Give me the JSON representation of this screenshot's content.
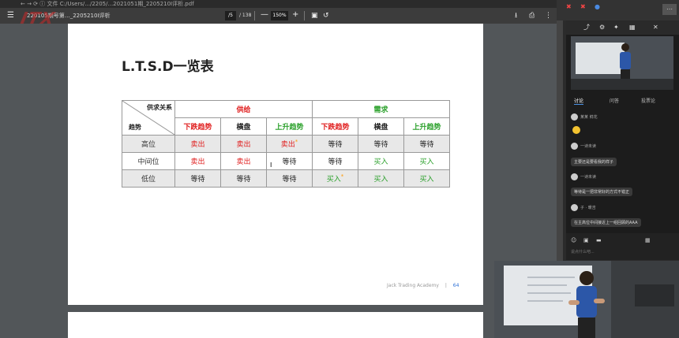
{
  "browser": {
    "url_text": "← → ⟳  ⓘ 文件  C:/Users/.../2205/...2021051期_2205210I评析.pdf"
  },
  "pdf_toolbar": {
    "menu_icon": "menu-icon",
    "file_name": "220105期号第…_2205210I评析",
    "current_page": "/5",
    "total_pages": "/ 138",
    "zoom_minus": "—",
    "zoom_value": "150%",
    "zoom_plus": "+",
    "download_icon": "download-icon",
    "print_icon": "print-icon",
    "more_icon": "more-vert-icon"
  },
  "watermark": "JTX",
  "document": {
    "title": "L.T.S.D一览表",
    "table": {
      "corner_top": "供求关系",
      "corner_bottom": "趋势",
      "group_supply": "供给",
      "group_demand": "需求",
      "subheaders": [
        {
          "text": "下跌趋势",
          "color": "red"
        },
        {
          "text": "横盘",
          "color": "blk"
        },
        {
          "text": "上升趋势",
          "color": "green"
        },
        {
          "text": "下跌趋势",
          "color": "red"
        },
        {
          "text": "横盘",
          "color": "blk"
        },
        {
          "text": "上升趋势",
          "color": "green"
        }
      ],
      "rows": [
        {
          "label": "高位",
          "cells": [
            {
              "text": "卖出",
              "color": "red",
              "star": ""
            },
            {
              "text": "卖出",
              "color": "red",
              "star": ""
            },
            {
              "text": "卖出",
              "color": "red",
              "star": "*"
            },
            {
              "text": "等待",
              "color": "blk",
              "star": ""
            },
            {
              "text": "等待",
              "color": "blk",
              "star": ""
            },
            {
              "text": "等待",
              "color": "blk",
              "star": ""
            }
          ]
        },
        {
          "label": "中间位",
          "cells": [
            {
              "text": "卖出",
              "color": "red",
              "star": ""
            },
            {
              "text": "卖出",
              "color": "red",
              "star": ""
            },
            {
              "text": "等待",
              "color": "blk",
              "star": ""
            },
            {
              "text": "等待",
              "color": "blk",
              "star": ""
            },
            {
              "text": "买入",
              "color": "green",
              "star": ""
            },
            {
              "text": "买入",
              "color": "green",
              "star": ""
            }
          ]
        },
        {
          "label": "低位",
          "cells": [
            {
              "text": "等待",
              "color": "blk",
              "star": ""
            },
            {
              "text": "等待",
              "color": "blk",
              "star": ""
            },
            {
              "text": "等待",
              "color": "blk",
              "star": ""
            },
            {
              "text": "买入",
              "color": "green",
              "star": "*"
            },
            {
              "text": "买入",
              "color": "green",
              "star": ""
            },
            {
              "text": "买入",
              "color": "green",
              "star": ""
            }
          ]
        }
      ]
    },
    "footer_text": "Jack Trading Academy",
    "footer_sep": "|",
    "page_number": "64"
  },
  "colors": {
    "red": "#e02020",
    "green": "#2aa02a",
    "supply_group": "#e02020",
    "demand_group": "#2aa02a"
  },
  "right_panel": {
    "top_icons": [
      "✖",
      "✖",
      "●"
    ],
    "chat_tabs": [
      "讨论",
      "问答",
      "投票论"
    ],
    "messages": [
      {
        "user": "某某 鲜花",
        "text": ""
      },
      {
        "user": "一诗未读",
        "text": "主要还是要看我的样子"
      },
      {
        "user": "一诗未读",
        "text": "等待是一把非常好的方式不错正"
      },
      {
        "user": "子 · 暖吉",
        "text": "在主高位中间接近上一组回顾的AAA"
      }
    ],
    "input_placeholder": "说点什么吧..."
  }
}
